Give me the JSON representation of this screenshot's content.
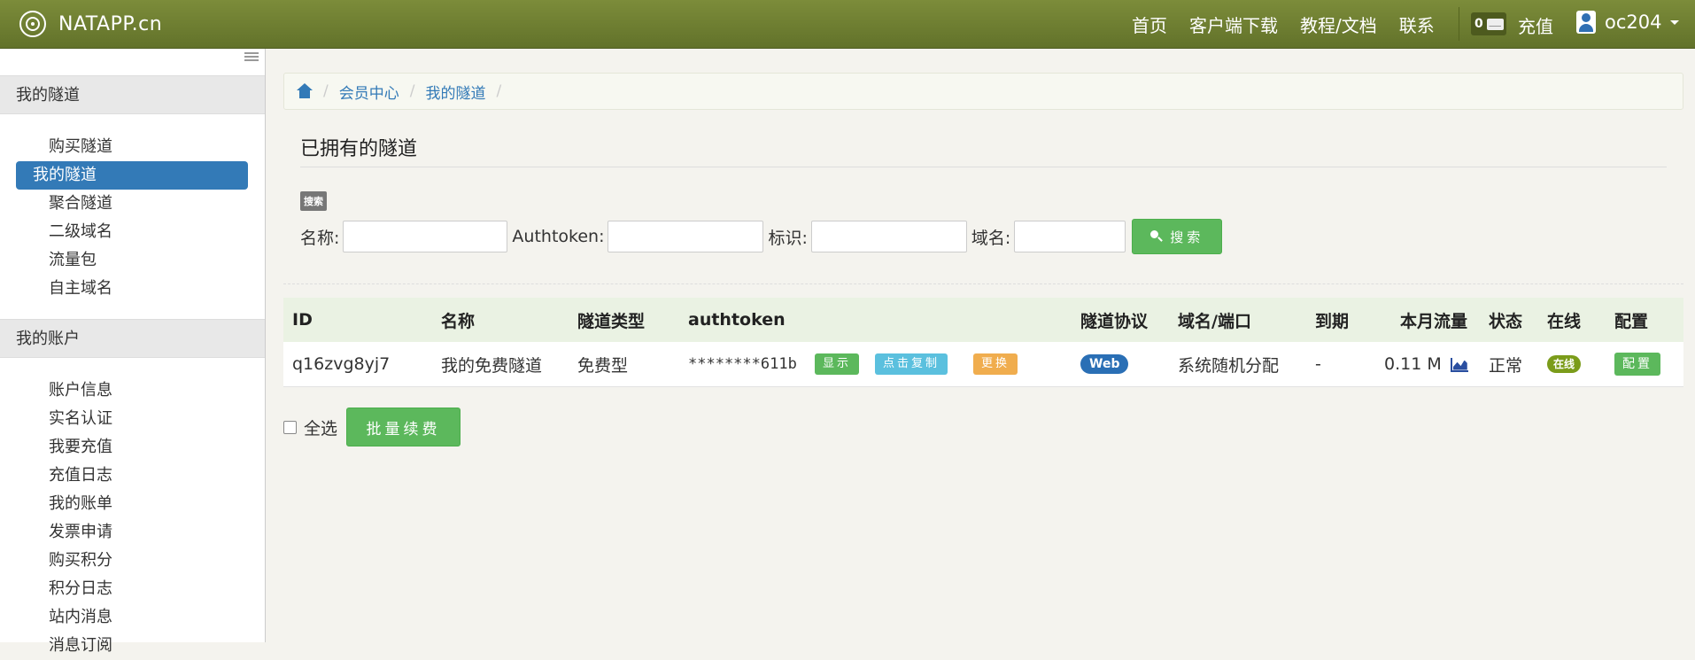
{
  "navbar": {
    "brand": "NATAPP.cn",
    "links": [
      "首页",
      "客户端下载",
      "教程/文档",
      "联系"
    ],
    "message_count": "0",
    "recharge": "充值",
    "username": "oc204"
  },
  "sidebar": {
    "section1_title": "我的隧道",
    "section1_items": [
      "购买隧道",
      "我的隧道",
      "聚合隧道",
      "二级域名",
      "流量包",
      "自主域名"
    ],
    "active_item": "我的隧道",
    "section2_title": "我的账户",
    "section2_items": [
      "账户信息",
      "实名认证",
      "我要充值",
      "充值日志",
      "我的账单",
      "发票申请",
      "购买积分",
      "积分日志",
      "站内消息",
      "消息订阅"
    ]
  },
  "breadcrumb": {
    "items": [
      "会员中心",
      "我的隧道"
    ]
  },
  "main": {
    "title": "已拥有的隧道",
    "search_tag": "搜索",
    "filters": [
      {
        "label": "名称:",
        "value": ""
      },
      {
        "label": "Authtoken:",
        "value": ""
      },
      {
        "label": "标识:",
        "value": ""
      },
      {
        "label": "域名:",
        "value": ""
      }
    ],
    "search_button": "搜索"
  },
  "table": {
    "headers": [
      "ID",
      "名称",
      "隧道类型",
      "authtoken",
      "隧道协议",
      "域名/端口",
      "到期",
      "本月流量",
      "状态",
      "在线",
      "配置"
    ],
    "rows": [
      {
        "id": "q16zvg8yj7",
        "name": "我的免费隧道",
        "type": "免费型",
        "authtoken": "********611b",
        "btn_show": "显示",
        "btn_copy": "点击复制",
        "btn_change": "更换",
        "protocol": "Web",
        "domain": "系统随机分配",
        "expire": "-",
        "traffic": "0.11 M",
        "status": "正常",
        "online": "在线",
        "config": "配置"
      }
    ]
  },
  "footer": {
    "select_all": "全选",
    "renew_button": "批量续费"
  }
}
